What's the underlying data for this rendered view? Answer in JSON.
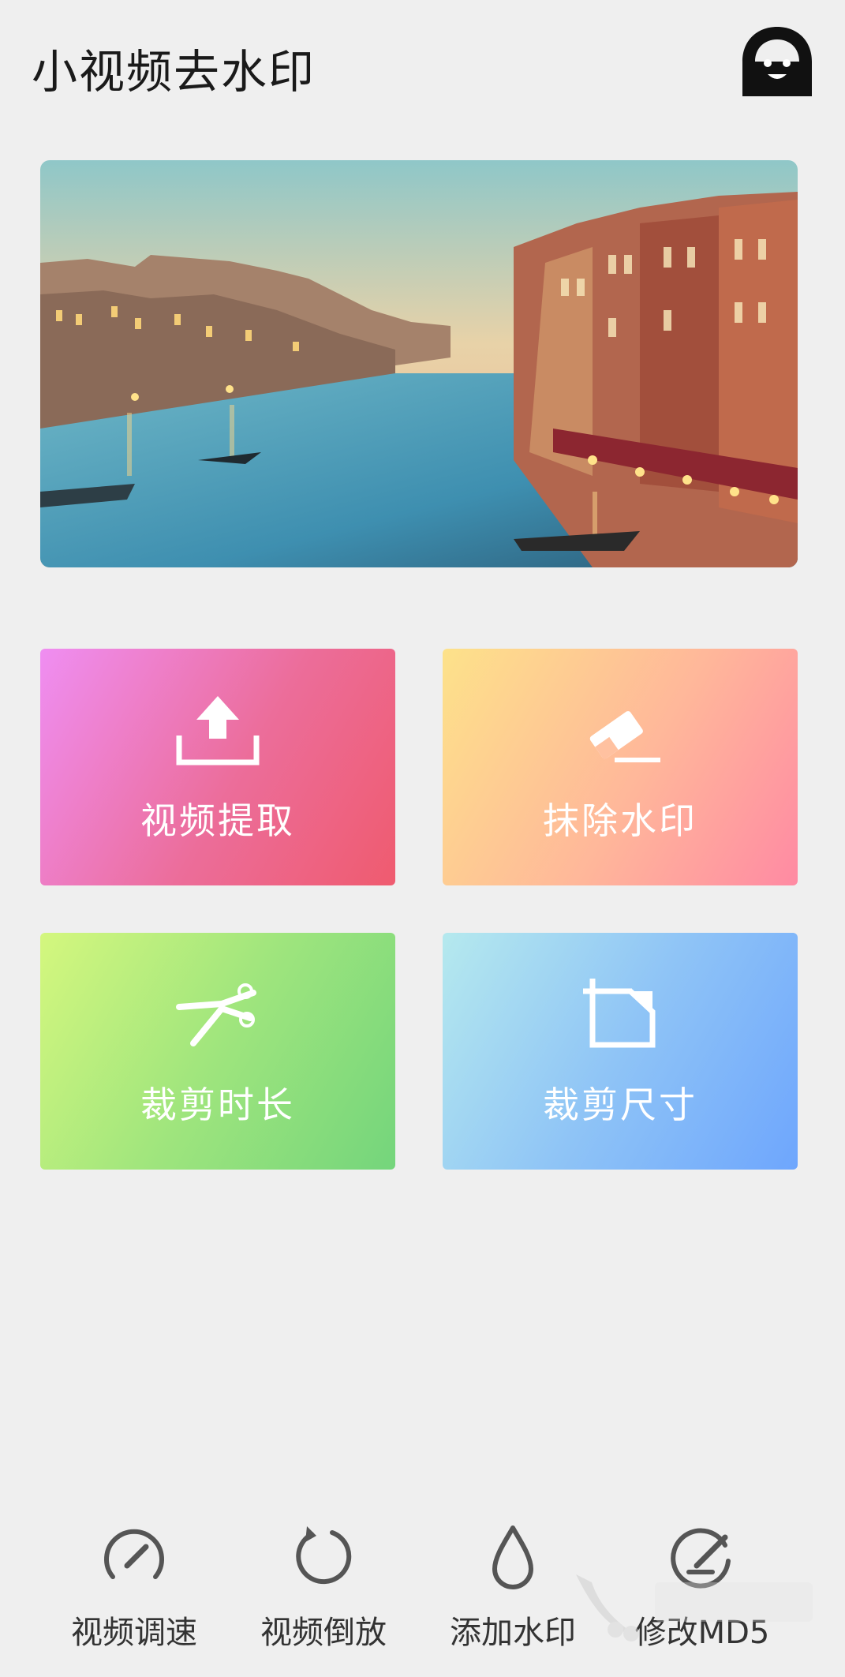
{
  "header": {
    "title": "小视频去水印",
    "avatar_icon": "ghost-face-icon"
  },
  "banner": {
    "image": "venice-canal-sunset"
  },
  "tiles": [
    {
      "id": "extract",
      "label": "视频提取",
      "icon": "upload-icon"
    },
    {
      "id": "erase",
      "label": "抹除水印",
      "icon": "eraser-icon"
    },
    {
      "id": "trim",
      "label": "裁剪时长",
      "icon": "scissors-icon"
    },
    {
      "id": "crop",
      "label": "裁剪尺寸",
      "icon": "crop-icon"
    }
  ],
  "bottom_nav": [
    {
      "id": "speed",
      "label": "视频调速",
      "icon": "speedometer-icon"
    },
    {
      "id": "reverse",
      "label": "视频倒放",
      "icon": "rotate-ccw-icon"
    },
    {
      "id": "watermark",
      "label": "添加水印",
      "icon": "droplet-icon"
    },
    {
      "id": "md5",
      "label": "修改MD5",
      "icon": "edit-circle-icon"
    }
  ],
  "colors": {
    "background": "#efefef",
    "tile_extract": "#ec6d9a",
    "tile_erase": "#ffb79a",
    "tile_trim": "#9fe57d",
    "tile_crop": "#8fc4f6",
    "nav_icon": "#555555"
  }
}
